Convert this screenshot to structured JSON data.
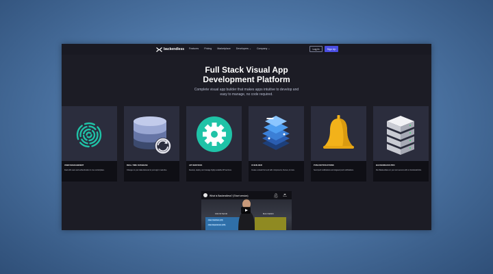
{
  "nav": {
    "brand": "backendless",
    "links": [
      "Features",
      "Pricing",
      "Marketplace",
      "Developers ⌄",
      "Company ⌄"
    ],
    "login": "Log In",
    "signup": "Sign Up"
  },
  "hero": {
    "title_line1": "Full Stack Visual App",
    "title_line2": "Development Platform",
    "subtitle": "Complete visual app builder that makes apps intuitive to develop and easy to manage, no code required."
  },
  "cards": [
    {
      "title": "USER MANAGEMENT",
      "desc": "Deal with users and authentication in one central place.",
      "icon": "fingerprint-icon"
    },
    {
      "title": "REAL-TIME DATABASE",
      "desc": "Changes to your data delivered to your app in real-time.",
      "icon": "database-sync-icon"
    },
    {
      "title": "API SERVICES",
      "desc": "Develop, deploy, and manage highly-scalable API services.",
      "icon": "gear-icon"
    },
    {
      "title": "UI BUILDER",
      "desc": "Create a visual front end with components, themes, & more.",
      "icon": "layers-icon"
    },
    {
      "title": "PUSH NOTIFICATIONS",
      "desc": "Send push notifications and targeted push notifications.",
      "icon": "bell-icon"
    },
    {
      "title": "BACKENDLESS PRO",
      "desc": "Run Backendless on your own servers with no functional limits.",
      "icon": "server-icon"
    }
  ],
  "video": {
    "title": "What is Backendless? (Short version)",
    "watch_later": "Watch Later",
    "share": "Share",
    "frontend_label": "FRONTEND",
    "backend_label": "BACKEND",
    "tag1": "User Interface (UI)",
    "tag2": "User Experience (UX)"
  },
  "colors": {
    "accent": "#4b4fe3",
    "page_bg": "#1c1c25",
    "card_bg": "#2b2d3d"
  }
}
